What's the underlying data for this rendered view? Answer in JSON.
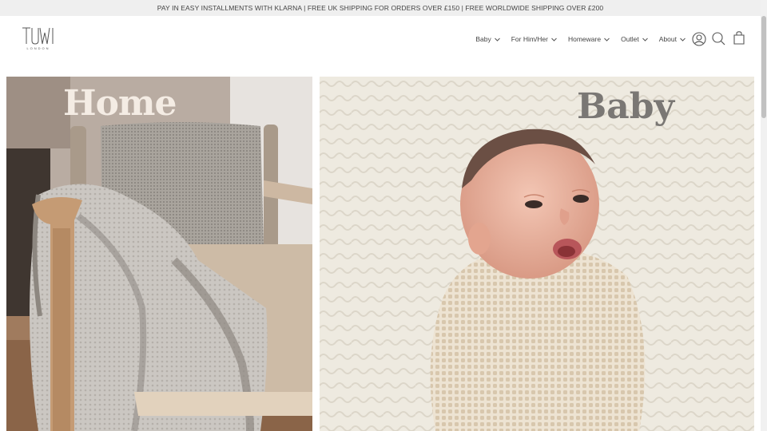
{
  "announcement": "PAY IN EASY INSTALLMENTS WITH KLARNA | FREE UK SHIPPING FOR ORDERS OVER £150 | FREE WORLDWIDE SHIPPING OVER £200",
  "logo": {
    "name": "TUWI",
    "subtitle": "LONDON"
  },
  "nav": [
    {
      "label": "Baby"
    },
    {
      "label": "For Him/Her"
    },
    {
      "label": "Homeware"
    },
    {
      "label": "Outlet"
    },
    {
      "label": "About"
    }
  ],
  "header_icons": [
    "account-icon",
    "search-icon",
    "cart-icon"
  ],
  "tiles": [
    {
      "title": "Home"
    },
    {
      "title": "Baby"
    }
  ],
  "colors": {
    "announcement_bg": "#efefef",
    "home_title": "#f4ece4",
    "baby_title": "#7a7774"
  }
}
